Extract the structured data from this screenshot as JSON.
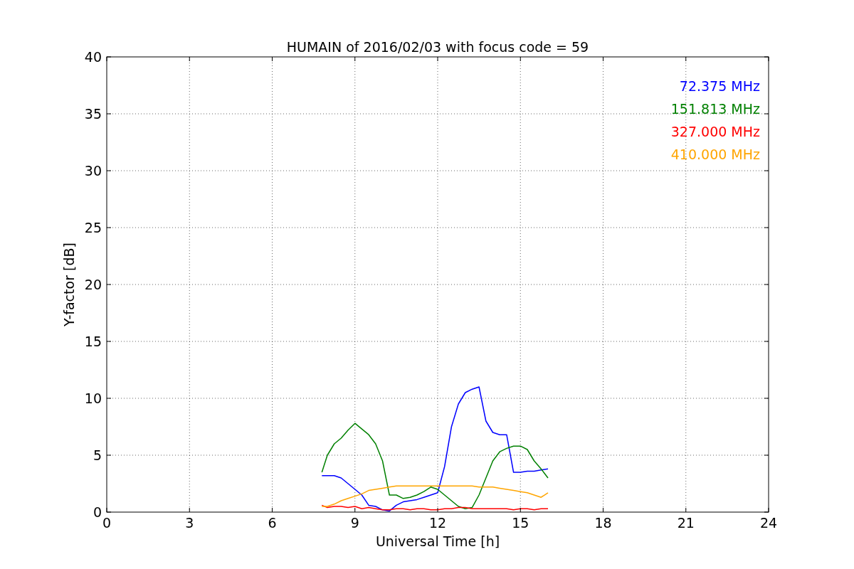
{
  "chart_data": {
    "type": "line",
    "title": "HUMAIN of 2016/02/03 with focus code = 59",
    "xlabel": "Universal Time [h]",
    "ylabel": "Y-factor [dB]",
    "x": [
      7.8,
      8,
      8.25,
      8.5,
      8.75,
      9,
      9.25,
      9.5,
      9.75,
      10,
      10.25,
      10.5,
      10.75,
      11,
      11.25,
      11.5,
      11.75,
      12,
      12.25,
      12.5,
      12.75,
      13,
      13.25,
      13.5,
      13.75,
      14,
      14.25,
      14.5,
      14.75,
      15,
      15.25,
      15.5,
      15.75,
      16
    ],
    "series": [
      {
        "name": "72.375 MHz",
        "color": "#0000ff",
        "values": [
          3.2,
          3.2,
          3.2,
          3,
          2.5,
          2,
          1.5,
          0.6,
          0.5,
          0.2,
          0.1,
          0.6,
          0.9,
          1,
          1.1,
          1.3,
          1.5,
          1.7,
          4,
          7.5,
          9.5,
          10.5,
          10.8,
          11,
          8,
          7,
          6.8,
          6.8,
          3.5,
          3.5,
          3.6,
          3.6,
          3.7,
          3.8
        ]
      },
      {
        "name": "151.813 MHz",
        "color": "#008000",
        "values": [
          3.5,
          5,
          6,
          6.5,
          7.2,
          7.8,
          7.3,
          6.8,
          6,
          4.5,
          1.5,
          1.5,
          1.2,
          1.3,
          1.5,
          1.8,
          2.2,
          2,
          1.5,
          1,
          0.5,
          0.3,
          0.4,
          1.5,
          3,
          4.5,
          5.3,
          5.6,
          5.8,
          5.8,
          5.5,
          4.5,
          3.8,
          3
        ]
      },
      {
        "name": "327.000 MHz",
        "color": "#ff0000",
        "values": [
          0.6,
          0.4,
          0.5,
          0.5,
          0.4,
          0.5,
          0.3,
          0.4,
          0.3,
          0.2,
          0.2,
          0.3,
          0.3,
          0.2,
          0.3,
          0.3,
          0.2,
          0.2,
          0.3,
          0.3,
          0.4,
          0.4,
          0.3,
          0.3,
          0.3,
          0.3,
          0.3,
          0.3,
          0.2,
          0.3,
          0.3,
          0.2,
          0.3,
          0.3
        ]
      },
      {
        "name": "410.000 MHz",
        "color": "#ffa500",
        "values": [
          0.5,
          0.5,
          0.7,
          1,
          1.2,
          1.4,
          1.6,
          1.9,
          2,
          2.1,
          2.2,
          2.3,
          2.3,
          2.3,
          2.3,
          2.3,
          2.3,
          2.3,
          2.3,
          2.3,
          2.3,
          2.3,
          2.3,
          2.2,
          2.2,
          2.2,
          2.1,
          2,
          1.9,
          1.8,
          1.7,
          1.5,
          1.3,
          1.7
        ]
      }
    ],
    "xlim": [
      0,
      24
    ],
    "ylim": [
      0,
      40
    ],
    "xticks": [
      0,
      3,
      6,
      9,
      12,
      15,
      18,
      21,
      24
    ],
    "yticks": [
      0,
      5,
      10,
      15,
      20,
      25,
      30,
      35,
      40
    ],
    "grid": true
  }
}
